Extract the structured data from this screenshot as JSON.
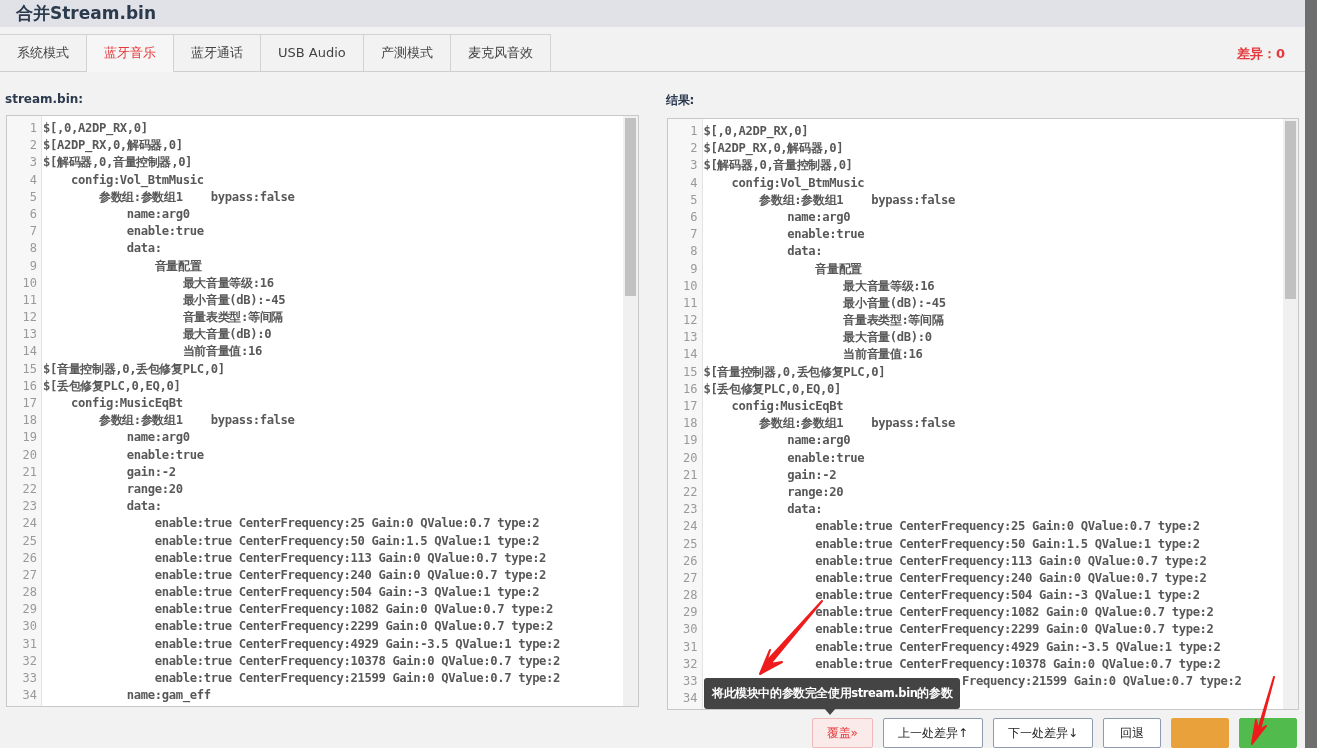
{
  "window": {
    "title": "合并Stream.bin"
  },
  "tabs": [
    {
      "label": "系统模式",
      "selected": false
    },
    {
      "label": "蓝牙音乐",
      "selected": true
    },
    {
      "label": "蓝牙通话",
      "selected": false
    },
    {
      "label": "USB Audio",
      "selected": false
    },
    {
      "label": "产测模式",
      "selected": false
    },
    {
      "label": "麦克风音效",
      "selected": false
    }
  ],
  "diff_count": "差异：0",
  "panels": [
    {
      "label": "stream.bin:",
      "lines": [
        {
          "number": "1",
          "text": "$[,0,A2DP_RX,0]"
        },
        {
          "number": "2",
          "text": "$[A2DP_RX,0,解码器,0]"
        },
        {
          "number": "3",
          "text": "$[解码器,0,音量控制器,0]"
        },
        {
          "number": "4",
          "text": "    config:Vol_BtmMusic"
        },
        {
          "number": "5",
          "text": "        参数组:参数组1    bypass:false"
        },
        {
          "number": "6",
          "text": "            name:arg0"
        },
        {
          "number": "7",
          "text": "            enable:true"
        },
        {
          "number": "8",
          "text": "            data:"
        },
        {
          "number": "9",
          "text": "                音量配置"
        },
        {
          "number": "10",
          "text": "                    最大音量等级:16"
        },
        {
          "number": "11",
          "text": "                    最小音量(dB):-45"
        },
        {
          "number": "12",
          "text": "                    音量表类型:等间隔"
        },
        {
          "number": "13",
          "text": "                    最大音量(dB):0"
        },
        {
          "number": "14",
          "text": "                    当前音量值:16"
        },
        {
          "number": "15",
          "text": "$[音量控制器,0,丢包修复PLC,0]"
        },
        {
          "number": "16",
          "text": "$[丢包修复PLC,0,EQ,0]"
        },
        {
          "number": "17",
          "text": "    config:MusicEqBt"
        },
        {
          "number": "18",
          "text": "        参数组:参数组1    bypass:false"
        },
        {
          "number": "19",
          "text": "            name:arg0"
        },
        {
          "number": "20",
          "text": "            enable:true"
        },
        {
          "number": "21",
          "text": "            gain:-2"
        },
        {
          "number": "22",
          "text": "            range:20"
        },
        {
          "number": "23",
          "text": "            data:"
        },
        {
          "number": "24",
          "text": "                enable:true CenterFrequency:25 Gain:0 QValue:0.7 type:2"
        },
        {
          "number": "25",
          "text": "                enable:true CenterFrequency:50 Gain:1.5 QValue:1 type:2"
        },
        {
          "number": "26",
          "text": "                enable:true CenterFrequency:113 Gain:0 QValue:0.7 type:2"
        },
        {
          "number": "27",
          "text": "                enable:true CenterFrequency:240 Gain:0 QValue:0.7 type:2"
        },
        {
          "number": "28",
          "text": "                enable:true CenterFrequency:504 Gain:-3 QValue:1 type:2"
        },
        {
          "number": "29",
          "text": "                enable:true CenterFrequency:1082 Gain:0 QValue:0.7 type:2"
        },
        {
          "number": "30",
          "text": "                enable:true CenterFrequency:2299 Gain:0 QValue:0.7 type:2"
        },
        {
          "number": "31",
          "text": "                enable:true CenterFrequency:4929 Gain:-3.5 QValue:1 type:2"
        },
        {
          "number": "32",
          "text": "                enable:true CenterFrequency:10378 Gain:0 QValue:0.7 type:2"
        },
        {
          "number": "33",
          "text": "                enable:true CenterFrequency:21599 Gain:0 QValue:0.7 type:2"
        },
        {
          "number": "34",
          "text": "            name:gam_eff"
        }
      ]
    },
    {
      "label": "结果:",
      "lines": [
        {
          "number": "1",
          "text": "$[,0,A2DP_RX,0]"
        },
        {
          "number": "2",
          "text": "$[A2DP_RX,0,解码器,0]"
        },
        {
          "number": "3",
          "text": "$[解码器,0,音量控制器,0]"
        },
        {
          "number": "4",
          "text": "    config:Vol_BtmMusic"
        },
        {
          "number": "5",
          "text": "        参数组:参数组1    bypass:false"
        },
        {
          "number": "6",
          "text": "            name:arg0"
        },
        {
          "number": "7",
          "text": "            enable:true"
        },
        {
          "number": "8",
          "text": "            data:"
        },
        {
          "number": "9",
          "text": "                音量配置"
        },
        {
          "number": "10",
          "text": "                    最大音量等级:16"
        },
        {
          "number": "11",
          "text": "                    最小音量(dB):-45"
        },
        {
          "number": "12",
          "text": "                    音量表类型:等间隔"
        },
        {
          "number": "13",
          "text": "                    最大音量(dB):0"
        },
        {
          "number": "14",
          "text": "                    当前音量值:16"
        },
        {
          "number": "15",
          "text": "$[音量控制器,0,丢包修复PLC,0]"
        },
        {
          "number": "16",
          "text": "$[丢包修复PLC,0,EQ,0]"
        },
        {
          "number": "17",
          "text": "    config:MusicEqBt"
        },
        {
          "number": "18",
          "text": "        参数组:参数组1    bypass:false"
        },
        {
          "number": "19",
          "text": "            name:arg0"
        },
        {
          "number": "20",
          "text": "            enable:true"
        },
        {
          "number": "21",
          "text": "            gain:-2"
        },
        {
          "number": "22",
          "text": "            range:20"
        },
        {
          "number": "23",
          "text": "            data:"
        },
        {
          "number": "24",
          "text": "                enable:true CenterFrequency:25 Gain:0 QValue:0.7 type:2"
        },
        {
          "number": "25",
          "text": "                enable:true CenterFrequency:50 Gain:1.5 QValue:1 type:2"
        },
        {
          "number": "26",
          "text": "                enable:true CenterFrequency:113 Gain:0 QValue:0.7 type:2"
        },
        {
          "number": "27",
          "text": "                enable:true CenterFrequency:240 Gain:0 QValue:0.7 type:2"
        },
        {
          "number": "28",
          "text": "                enable:true CenterFrequency:504 Gain:-3 QValue:1 type:2"
        },
        {
          "number": "29",
          "text": "                enable:true CenterFrequency:1082 Gain:0 QValue:0.7 type:2"
        },
        {
          "number": "30",
          "text": "                enable:true CenterFrequency:2299 Gain:0 QValue:0.7 type:2"
        },
        {
          "number": "31",
          "text": "                enable:true CenterFrequency:4929 Gain:-3.5 QValue:1 type:2"
        },
        {
          "number": "32",
          "text": "                enable:true CenterFrequency:10378 Gain:0 QValue:0.7 type:2"
        },
        {
          "number": "33",
          "text": "                                     Frequency:21599 Gain:0 QValue:0.7 type:2"
        },
        {
          "number": "34"
        }
      ]
    }
  ],
  "tooltip": "将此模块中的参数完全使用stream.bin的参数",
  "buttons": [
    {
      "label": "覆盖»",
      "kind": "danger"
    },
    {
      "label": "上一处差异↑",
      "kind": "default"
    },
    {
      "label": "下一处差异↓",
      "kind": "default"
    },
    {
      "label": "回退",
      "kind": "default"
    },
    {
      "kind": "warning"
    },
    {
      "kind": "success"
    }
  ]
}
